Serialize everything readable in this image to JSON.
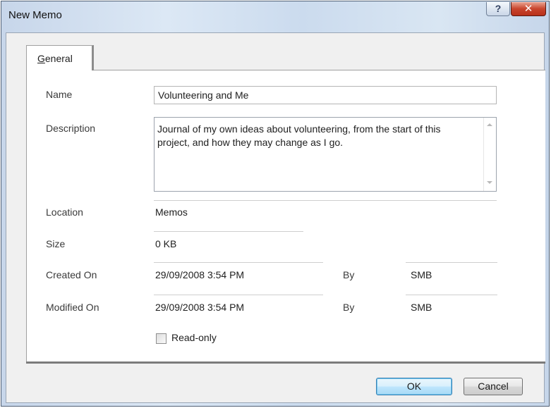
{
  "window": {
    "title": "New Memo",
    "help_glyph": "?",
    "close_glyph": "✕"
  },
  "tabs": [
    {
      "label": "General",
      "selected": true
    }
  ],
  "form": {
    "name": {
      "label": "Name",
      "value": "Volunteering and Me"
    },
    "description": {
      "label": "Description",
      "value": "Journal of my own ideas about volunteering, from the start of this project, and how they may change as I go."
    },
    "location": {
      "label": "Location",
      "value": "Memos"
    },
    "size": {
      "label": "Size",
      "value": "0 KB"
    },
    "created_on": {
      "label": "Created On",
      "value": "29/09/2008 3:54 PM",
      "by_label": "By",
      "by_value": "SMB"
    },
    "modified_on": {
      "label": "Modified On",
      "value": "29/09/2008 3:54 PM",
      "by_label": "By",
      "by_value": "SMB"
    },
    "read_only": {
      "label": "Read-only",
      "checked": false
    }
  },
  "buttons": {
    "ok": "OK",
    "cancel": "Cancel"
  },
  "colors": {
    "title_bar": "#cfdcee",
    "close_button": "#c9452d",
    "default_button_border": "#3c7fb1"
  }
}
